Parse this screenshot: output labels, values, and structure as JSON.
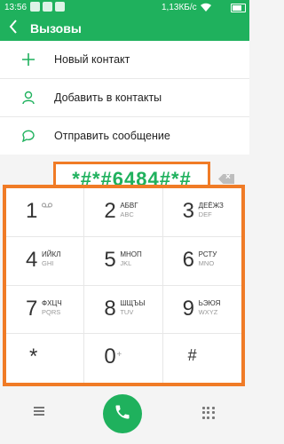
{
  "status_bar": {
    "time": "13:56",
    "network_speed": "1,13КБ/с"
  },
  "app_bar": {
    "title": "Вызовы"
  },
  "menu": [
    {
      "label": "Новый контакт",
      "icon": "plus-icon"
    },
    {
      "label": "Добавить в контакты",
      "icon": "person-icon"
    },
    {
      "label": "Отправить сообщение",
      "icon": "message-icon"
    }
  ],
  "dialed_number": "*#*#6484#*#",
  "keypad": {
    "keys": [
      {
        "digit": "1",
        "letters": "",
        "sub": ""
      },
      {
        "digit": "2",
        "letters": "АБВГ",
        "sub": "ABC"
      },
      {
        "digit": "3",
        "letters": "ДЕЁЖЗ",
        "sub": "DEF"
      },
      {
        "digit": "4",
        "letters": "ИЙКЛ",
        "sub": "GHI"
      },
      {
        "digit": "5",
        "letters": "МНОП",
        "sub": "JKL"
      },
      {
        "digit": "6",
        "letters": "РСТУ",
        "sub": "MNO"
      },
      {
        "digit": "7",
        "letters": "ФХЦЧ",
        "sub": "PQRS"
      },
      {
        "digit": "8",
        "letters": "ШЩЪЫ",
        "sub": "TUV"
      },
      {
        "digit": "9",
        "letters": "ЬЭЮЯ",
        "sub": "WXYZ"
      }
    ],
    "star": "*",
    "zero": "0",
    "zero_sub": "+",
    "hash": "#"
  },
  "colors": {
    "accent": "#1fb15d",
    "highlight": "#f07b26"
  }
}
